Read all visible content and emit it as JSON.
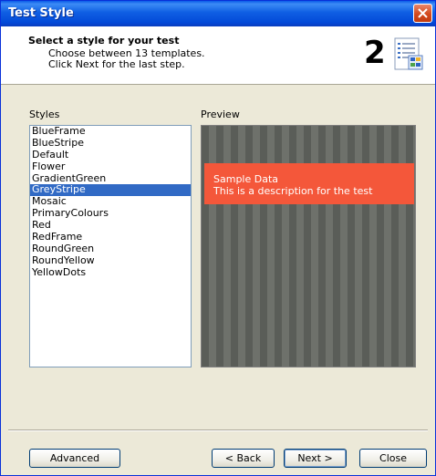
{
  "window": {
    "title": "Test Style"
  },
  "header": {
    "title": "Select a style for your test",
    "line1": "Choose between 13 templates.",
    "line2": "Click Next for the last step.",
    "step": "2"
  },
  "styles": {
    "label": "Styles",
    "items": [
      "BlueFrame",
      "BlueStripe",
      "Default",
      "Flower",
      "GradientGreen",
      "GreyStripe",
      "Mosaic",
      "PrimaryColours",
      "Red",
      "RedFrame",
      "RoundGreen",
      "RoundYellow",
      "YellowDots"
    ],
    "selected": "GreyStripe"
  },
  "preview": {
    "label": "Preview",
    "sample_title": "Sample Data",
    "sample_desc": "This is a description for the test"
  },
  "buttons": {
    "advanced": "Advanced",
    "back": "< Back",
    "next": "Next >",
    "close": "Close"
  },
  "colors": {
    "banner": "#f4573a",
    "selection": "#316ac5",
    "titlebar": "#0a5be8"
  }
}
